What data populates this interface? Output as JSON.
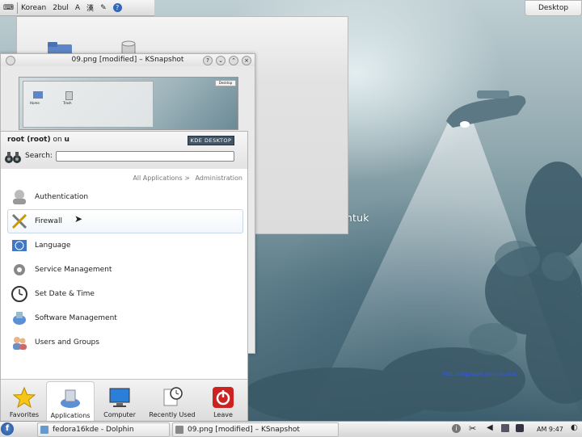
{
  "tray": {
    "korean": "Korean",
    "layout": "2bul",
    "a": "A"
  },
  "desktop": {
    "button": "Desktop",
    "watermark": "blog.naver.com/ubuntuk",
    "watermark_small": "http://blog.naver.com/ubuntuk"
  },
  "ksnapshot": {
    "title": "09.png [modified] – KSnapshot",
    "preview_desktop": "Desktop",
    "preview_home": "Home",
    "preview_trash": "Trash"
  },
  "kickoff": {
    "user_name": "root (root)",
    "user_on": "on",
    "host": "u",
    "badge": "KDE DESKTOP",
    "search_label": "Search:",
    "search_value": "",
    "breadcrumb_root": "All Applications >",
    "breadcrumb_current": "Administration",
    "items": [
      {
        "label": "Authentication",
        "icon": "authentication-icon"
      },
      {
        "label": "Firewall",
        "icon": "firewall-icon"
      },
      {
        "label": "Language",
        "icon": "language-icon"
      },
      {
        "label": "Service Management",
        "icon": "service-management-icon"
      },
      {
        "label": "Set Date & Time",
        "icon": "clock-icon"
      },
      {
        "label": "Software Management",
        "icon": "software-icon"
      },
      {
        "label": "Users and Groups",
        "icon": "users-icon"
      }
    ],
    "tabs": [
      {
        "label": "Favorites",
        "icon": "star-icon"
      },
      {
        "label": "Applications",
        "icon": "applications-icon"
      },
      {
        "label": "Computer",
        "icon": "monitor-icon"
      },
      {
        "label": "Recently Used",
        "icon": "recent-icon"
      },
      {
        "label": "Leave",
        "icon": "power-icon"
      }
    ]
  },
  "taskbar": {
    "tasks": [
      {
        "label": "fedora16kde - Dolphin"
      },
      {
        "label": "09.png [modified] – KSnapshot"
      }
    ],
    "clock": "AM 9:47"
  },
  "colors": {
    "accent": "#5a8ed0",
    "leave_red": "#cc2222",
    "star_gold": "#f5c518"
  }
}
